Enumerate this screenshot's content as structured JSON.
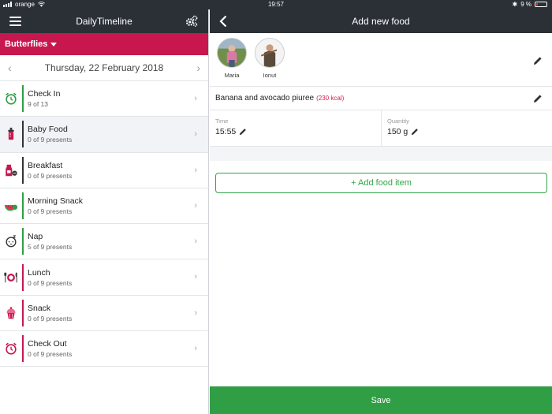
{
  "status_bar": {
    "carrier": "orange",
    "time": "19:57",
    "battery": "9 %"
  },
  "left": {
    "title": "DailyTimeline",
    "group": "Butterflies",
    "date": {
      "weekday": "Thursday,",
      "date": "22 February 2018"
    },
    "items": [
      {
        "title": "Check In",
        "sub": "9 of 13",
        "icon": "alarm-clock-icon",
        "color": "#2e9e44"
      },
      {
        "title": "Baby Food",
        "sub": "0 of 9 presents",
        "icon": "baby-bottle-icon",
        "color": "#333333"
      },
      {
        "title": "Breakfast",
        "sub": "0 of 9 presents",
        "icon": "milk-bottle-icon",
        "color": "#333333"
      },
      {
        "title": "Morning Snack",
        "sub": "0 of 9 presents",
        "icon": "apple-watermelon-icon",
        "color": "#2e9e44"
      },
      {
        "title": "Nap",
        "sub": "5 of 9 presents",
        "icon": "sleeping-face-icon",
        "color": "#2e9e44"
      },
      {
        "title": "Lunch",
        "sub": "0 of 9 presents",
        "icon": "plate-cutlery-icon",
        "color": "#c8174e"
      },
      {
        "title": "Snack",
        "sub": "0 of 9 presents",
        "icon": "cupcake-icon",
        "color": "#c8174e"
      },
      {
        "title": "Check Out",
        "sub": "0 of 9 presents",
        "icon": "alarm-clock-icon",
        "color": "#c8174e"
      }
    ]
  },
  "right": {
    "title": "Add new food",
    "children": [
      {
        "name": "Maria"
      },
      {
        "name": "Ionut"
      }
    ],
    "food": {
      "name": "Banana and avocado piuree",
      "kcal": "(230 kcal)"
    },
    "time": {
      "label": "Time",
      "value": "15:55"
    },
    "quantity": {
      "label": "Quantity",
      "value": "150 g"
    },
    "add_item_label": "+ Add food item",
    "save_label": "Save"
  },
  "colors": {
    "nav": "#2b2f36",
    "accent": "#c8174e",
    "green": "#2f9e44"
  }
}
